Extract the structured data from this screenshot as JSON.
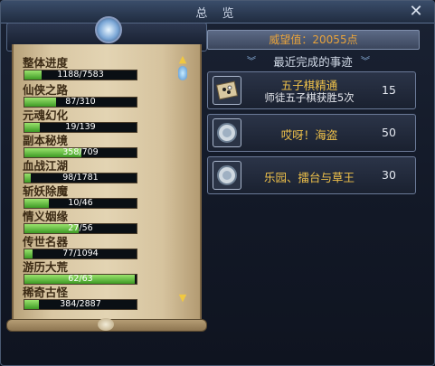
{
  "window": {
    "title": "总 览"
  },
  "summary": {
    "prestige_text": "威望值：20055点"
  },
  "progress": {
    "items": [
      {
        "label": "整体进度",
        "text": "1188/7583",
        "fraction": 0.157
      },
      {
        "label": "仙侠之路",
        "text": "87/310",
        "fraction": 0.281
      },
      {
        "label": "元魂幻化",
        "text": "19/139",
        "fraction": 0.137
      },
      {
        "label": "副本秘境",
        "text": "358/709",
        "fraction": 0.505
      },
      {
        "label": "血战江湖",
        "text": "98/1781",
        "fraction": 0.055
      },
      {
        "label": "斩妖除魔",
        "text": "10/46",
        "fraction": 0.217
      },
      {
        "label": "情义姻缘",
        "text": "27/56",
        "fraction": 0.482
      },
      {
        "label": "传世名器",
        "text": "77/1094",
        "fraction": 0.07
      },
      {
        "label": "游历大荒",
        "text": "62/63",
        "fraction": 0.984
      },
      {
        "label": "稀奇古怪",
        "text": "384/2887",
        "fraction": 0.133
      }
    ]
  },
  "recent": {
    "header": "最近完成的事迹",
    "items": [
      {
        "name": "五子棋精通",
        "desc": "师徒五子棋获胜5次",
        "points": "15",
        "icon": "gomoku-board-icon"
      },
      {
        "name": "哎呀！海盗",
        "desc": "",
        "points": "50",
        "icon": "achievement-medal-icon"
      },
      {
        "name": "乐园、擂台与草王",
        "desc": "",
        "points": "30",
        "icon": "achievement-medal-icon"
      }
    ]
  },
  "colors": {
    "progress_fill": "#5cc23a",
    "achievement_name": "#f0c24a",
    "prestige": "#e8a33c"
  }
}
